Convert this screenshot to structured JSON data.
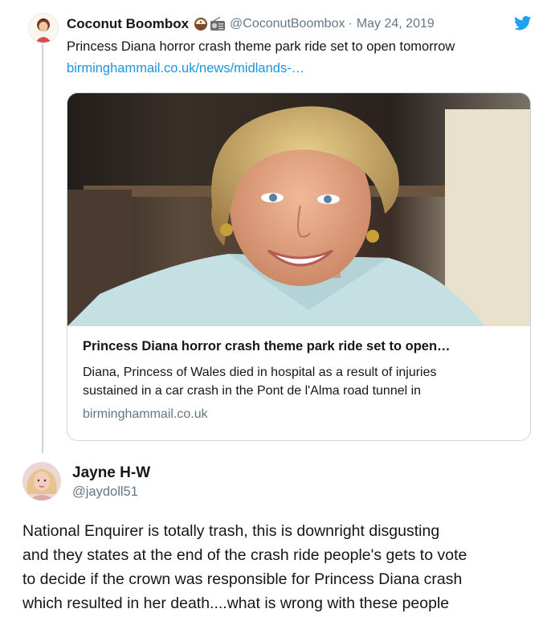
{
  "quoted_tweet": {
    "display_name": "Coconut Boombox",
    "badges": [
      "coconut-emoji",
      "radio-emoji"
    ],
    "handle": "@CoconutBoombox",
    "separator": "·",
    "date": "May 24, 2019",
    "text": "Princess Diana horror crash theme park ride set to open tomorrow",
    "link": "birminghammail.co.uk/news/midlands-…",
    "card": {
      "title": "Princess Diana horror crash theme park ride set to open…",
      "description_lines": [
        "Diana, Princess of Wales died in hospital as a result of injuries",
        "sustained in a car crash in the Pont de l'Alma road tunnel in"
      ],
      "domain": "birminghammail.co.uk"
    }
  },
  "reply": {
    "display_name": "Jayne H-W",
    "handle": "@jaydoll51",
    "text_lines": [
      "National Enquirer is totally trash,  this is downright disgusting",
      "and they states at the end of the crash ride people's gets to vote",
      "to decide if the crown was responsible for Princess Diana crash",
      "which resulted in her death....what is wrong with these people"
    ]
  },
  "colors": {
    "text": "#14171a",
    "muted": "#657786",
    "link": "#1b95e0",
    "border": "#ccd6dd",
    "twitter_blue": "#1da1f2"
  }
}
